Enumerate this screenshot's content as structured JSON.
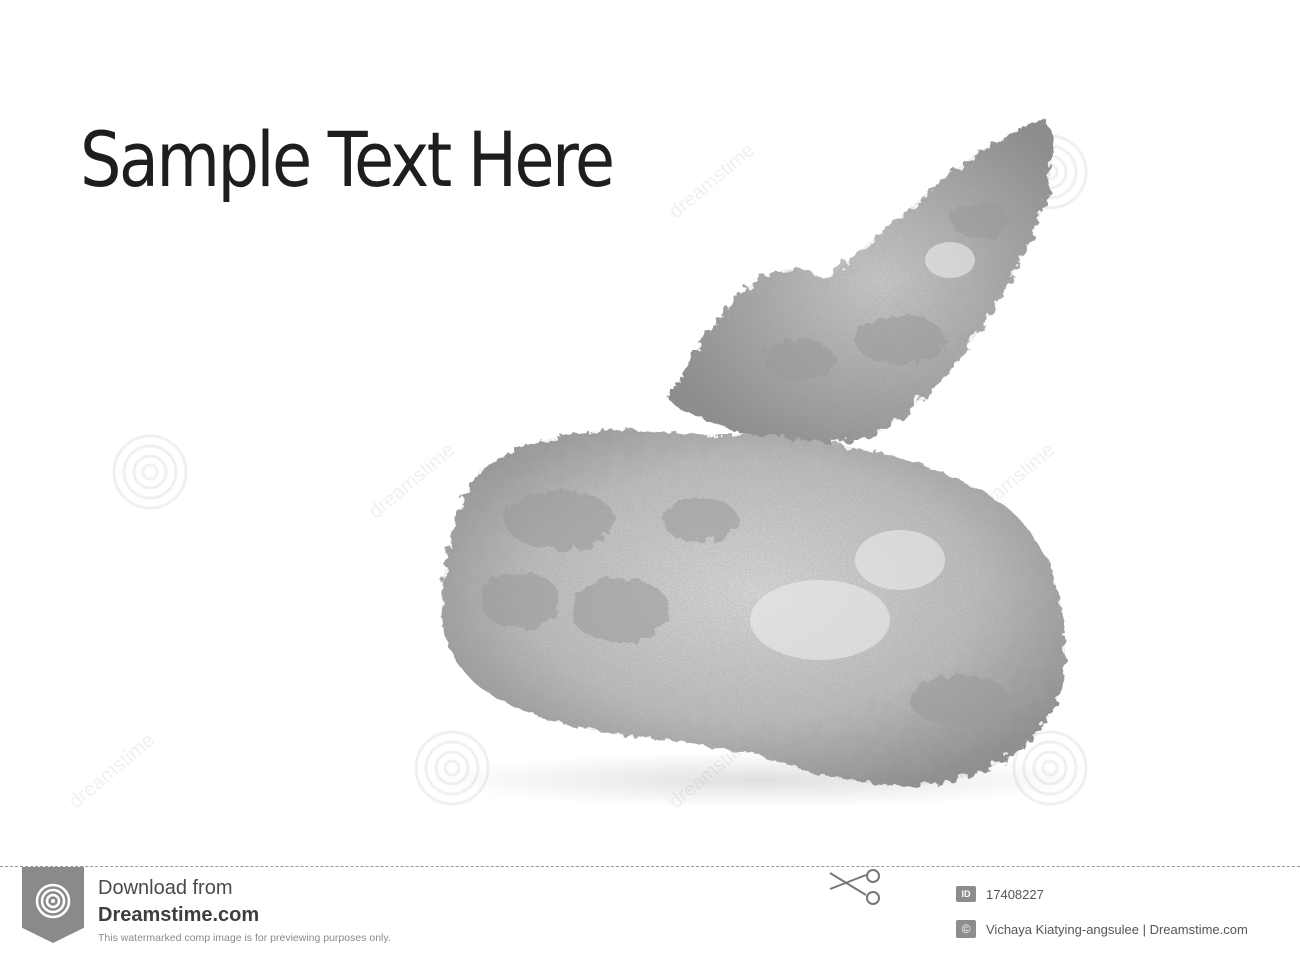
{
  "headline": "Sample Text Here",
  "watermark_text": "dreamstime",
  "footer": {
    "download_line1": "Download from",
    "download_line2": "Dreamstime.com",
    "note": "This watermarked comp image is for previewing purposes only.",
    "id_label": "ID",
    "image_id": "17408227",
    "copyright_symbol": "©",
    "credit": "Vichaya Kiatying-angsulee | Dreamstime.com"
  },
  "icons": [
    "dreamstime-logo-icon",
    "scissors-icon",
    "id-icon",
    "copyright-icon"
  ]
}
